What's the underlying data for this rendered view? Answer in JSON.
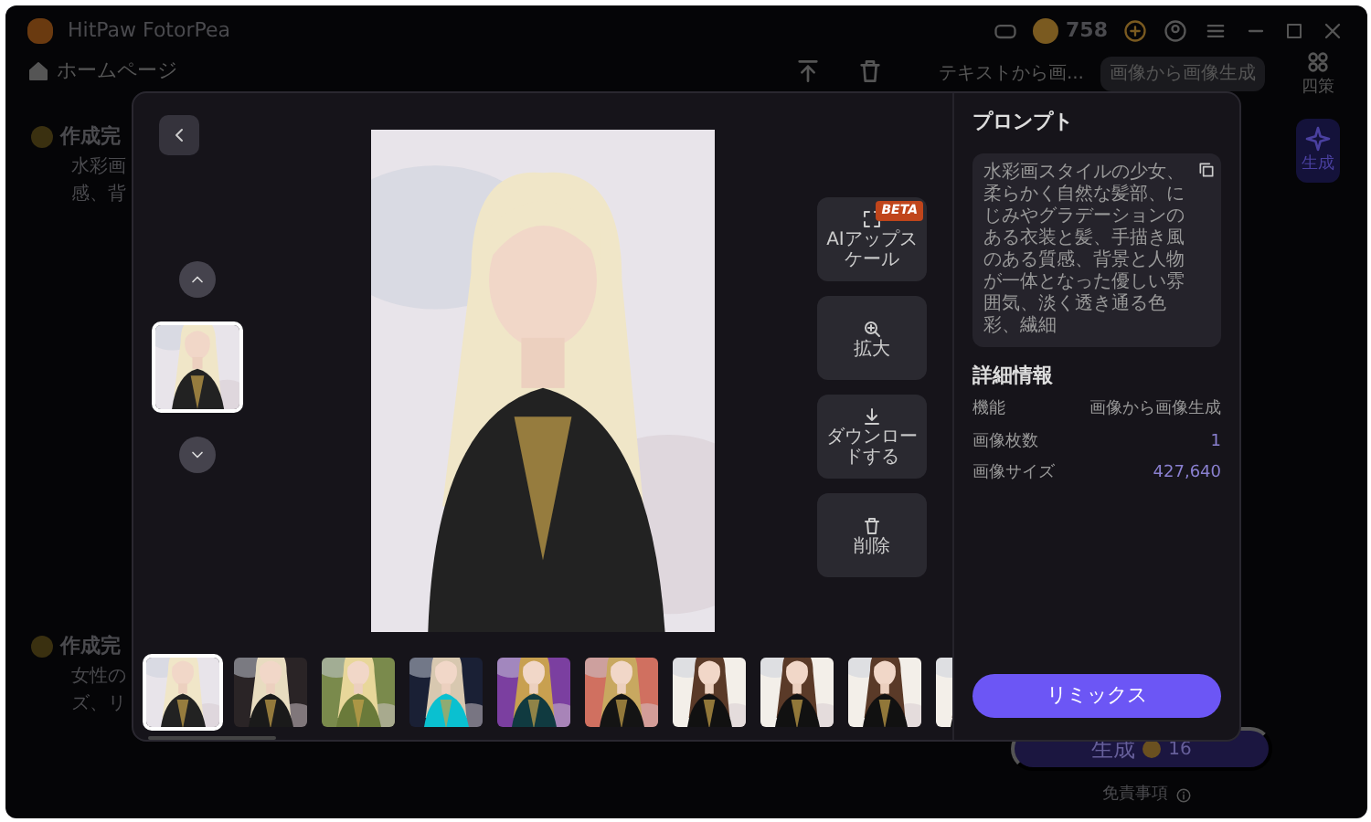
{
  "app": {
    "title": "HitPaw FotorPea",
    "coins": "758",
    "nav": "ホームページ",
    "tabs": [
      {
        "label": "テキストから画...",
        "selected": false
      },
      {
        "label": "画像から画像生成",
        "selected": true
      }
    ],
    "side_items": [
      {
        "label": "四策",
        "selected": false
      },
      {
        "label": "生成",
        "selected": true
      }
    ],
    "results": [
      {
        "title": "作成完",
        "text": [
          "水彩画",
          "感、背"
        ]
      },
      {
        "title": "作成完",
        "text": [
          "女性の",
          "ズ、リ"
        ]
      }
    ],
    "generate": {
      "label": "生成",
      "cost": "16"
    },
    "disclaimer": "免責事項"
  },
  "viewer": {
    "thumbs": [
      {
        "kind": "picture",
        "selected": true
      }
    ],
    "image": {
      "kind": "picture"
    },
    "actions": [
      {
        "kind": "upscale",
        "label": "AIアップスケール",
        "badge": "BETA"
      },
      {
        "kind": "zoom",
        "label": "拡大"
      },
      {
        "kind": "download",
        "label": "ダウンロードする"
      },
      {
        "kind": "delete",
        "label": "削除"
      }
    ],
    "strip": [
      {
        "kind": "picture",
        "selected": true
      },
      {
        "kind": "picture",
        "selected": false
      },
      {
        "kind": "picture",
        "selected": false
      },
      {
        "kind": "picture",
        "selected": false
      },
      {
        "kind": "picture",
        "selected": false
      },
      {
        "kind": "picture",
        "selected": false
      },
      {
        "kind": "picture",
        "selected": false
      },
      {
        "kind": "picture",
        "selected": false
      },
      {
        "kind": "picture",
        "selected": false
      },
      {
        "kind": "picture",
        "selected": false
      }
    ],
    "prompt_title": "プロンプト",
    "prompt": "水彩画スタイルの少女、柔らかく自然な髪部、にじみやグラデーションのある衣装と髪、手描き風のある質感、背景と人物が一体となった優しい雰囲気、淡く透き通る色彩、繊細",
    "details_title": "詳細情報",
    "details": [
      {
        "label": "機能",
        "value": "画像から画像生成"
      },
      {
        "label": "画像枚数",
        "value": "1"
      },
      {
        "label": "画像サイズ",
        "value": "427,640"
      }
    ],
    "remix": "リミックス"
  }
}
